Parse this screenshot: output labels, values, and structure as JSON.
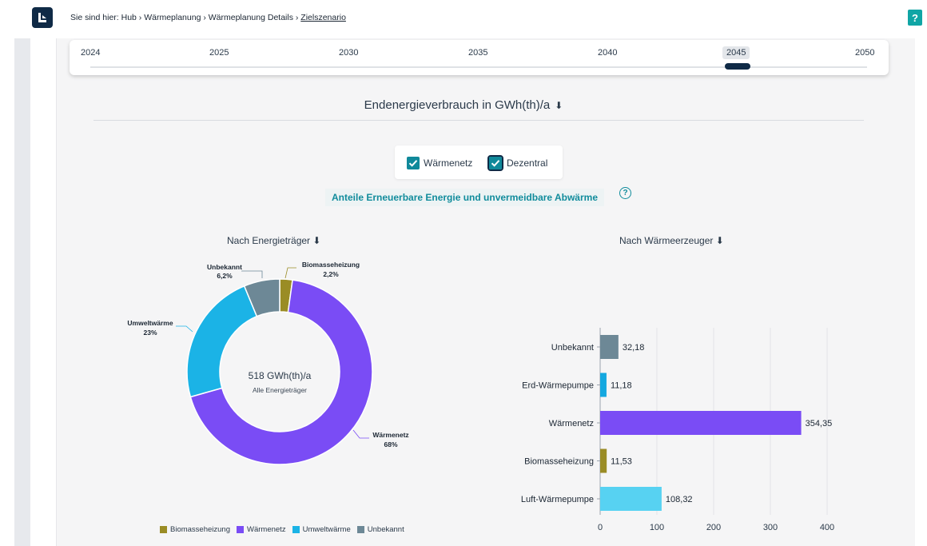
{
  "header": {
    "breadcrumb": {
      "prefix": "Sie sind hier: Hub › Wärmeplanung › Wärmeplanung Details › ",
      "current": "Zielszenario"
    },
    "help_label": "?"
  },
  "timeline": {
    "years": [
      "2024",
      "2025",
      "2030",
      "2035",
      "2040",
      "2045",
      "2050"
    ],
    "selected": "2045"
  },
  "title": "Endenergieverbrauch in GWh(th)/a",
  "filters": {
    "waermenetz": {
      "label": "Wärmenetz",
      "checked": true
    },
    "dezentral": {
      "label": "Dezentral",
      "checked": true
    }
  },
  "ee_link": "Anteile Erneuerbare Energie und unvermeidbare Abwärme",
  "colors": {
    "biomasse": "#9a8c25",
    "waermenetz": "#7a4cf5",
    "umwelt": "#1bb3e6",
    "unbekannt": "#6d8896",
    "luft": "#57d2f2",
    "erd": "#14a8e0"
  },
  "donut": {
    "subtitle": "Nach Energieträger",
    "center_value": "518 GWh(th)/a",
    "center_label": "Alle Energieträger",
    "labels": {
      "unbekannt_name": "Unbekannt",
      "unbekannt_pct": "6,2%",
      "biomasse_name": "Biomasseheizung",
      "biomasse_pct": "2,2%",
      "umwelt_name": "Umweltwärme",
      "umwelt_pct": "23%",
      "waermenetz_name": "Wärmenetz",
      "waermenetz_pct": "68%"
    },
    "legend": [
      "Biomasseheizung",
      "Wärmenetz",
      "Umweltwärme",
      "Unbekannt"
    ]
  },
  "bar": {
    "subtitle": "Nach Wärmeerzeuger",
    "ticks": [
      "0",
      "100",
      "200",
      "300",
      "400"
    ]
  },
  "chart_data": [
    {
      "type": "pie",
      "title": "Nach Energieträger",
      "categories": [
        "Biomasseheizung",
        "Wärmenetz",
        "Umweltwärme",
        "Unbekannt"
      ],
      "values": [
        2.2,
        68,
        23,
        6.2
      ]
    },
    {
      "type": "bar",
      "title": "Nach Wärmeerzeuger",
      "categories": [
        "Unbekannt",
        "Erd-Wärmepumpe",
        "Wärmenetz",
        "Biomasseheizung",
        "Luft-Wärmepumpe"
      ],
      "values": [
        32.18,
        11.18,
        354.35,
        11.53,
        108.32
      ],
      "value_labels": [
        "32,18",
        "11,18",
        "354,35",
        "11,53",
        "108,32"
      ],
      "xlim": [
        0,
        400
      ]
    }
  ]
}
